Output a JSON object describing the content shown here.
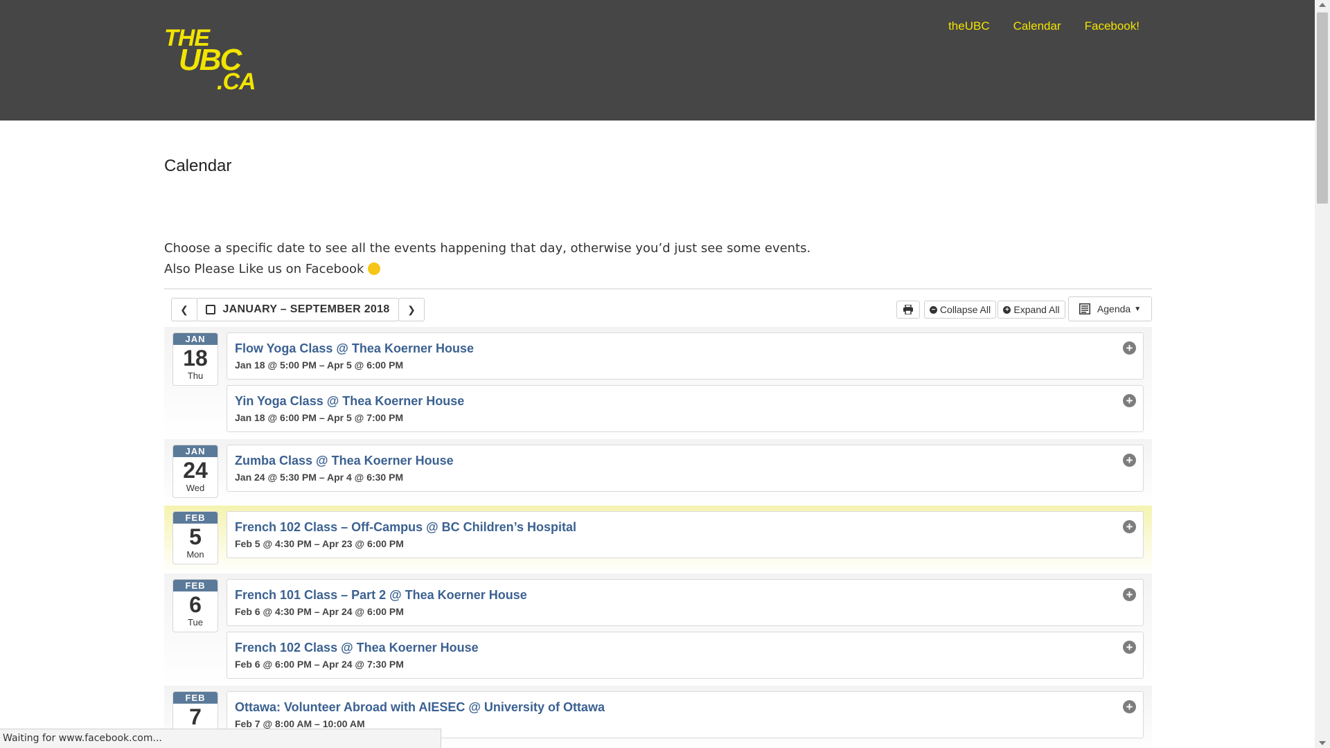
{
  "header": {
    "logo_lines": [
      "THE",
      "UBC",
      ".CA"
    ],
    "nav": [
      "theUBC",
      "Calendar",
      "Facebook!"
    ]
  },
  "page": {
    "title": "Calendar",
    "intro_line1": "Choose a specific date to see all the events happening that day, otherwise you’d just see some events.",
    "intro_line2": "Also Please Like us on Facebook"
  },
  "toolbar": {
    "range_label": "JANUARY – SEPTEMBER 2018",
    "collapse_label": "Collapse All",
    "expand_label": "Expand All",
    "view_label": "Agenda"
  },
  "days": [
    {
      "month": "JAN",
      "day": "18",
      "weekday": "Thu",
      "events": [
        {
          "title": "Flow Yoga Class @ Thea Koerner House",
          "time": "Jan 18 @ 5:00 PM – Apr 5 @ 6:00 PM"
        },
        {
          "title": "Yin Yoga Class @ Thea Koerner House",
          "time": "Jan 18 @ 6:00 PM – Apr 5 @ 7:00 PM"
        }
      ]
    },
    {
      "month": "JAN",
      "day": "24",
      "weekday": "Wed",
      "events": [
        {
          "title": "Zumba Class @ Thea Koerner House",
          "time": "Jan 24 @ 5:30 PM – Apr 4 @ 6:30 PM"
        }
      ]
    },
    {
      "month": "FEB",
      "day": "5",
      "weekday": "Mon",
      "events": [
        {
          "title": "French 102 Class – Off-Campus @ BC Children’s Hospital",
          "time": "Feb 5 @ 4:30 PM – Apr 23 @ 6:00 PM"
        }
      ]
    },
    {
      "month": "FEB",
      "day": "6",
      "weekday": "Tue",
      "events": [
        {
          "title": "French 101 Class – Part 2 @ Thea Koerner House",
          "time": "Feb 6 @ 4:30 PM – Apr 24 @ 6:00 PM"
        },
        {
          "title": "French 102 Class @ Thea Koerner House",
          "time": "Feb 6 @ 6:00 PM – Apr 24 @ 7:30 PM"
        }
      ]
    },
    {
      "month": "FEB",
      "day": "7",
      "weekday": "",
      "events": [
        {
          "title": "Ottawa: Volunteer Abroad with AIESEC @ University of Ottawa",
          "time": "Feb 7 @ 8:00 AM – 10:00 AM"
        }
      ]
    }
  ],
  "status_bar": "Waiting for www.facebook.com..."
}
